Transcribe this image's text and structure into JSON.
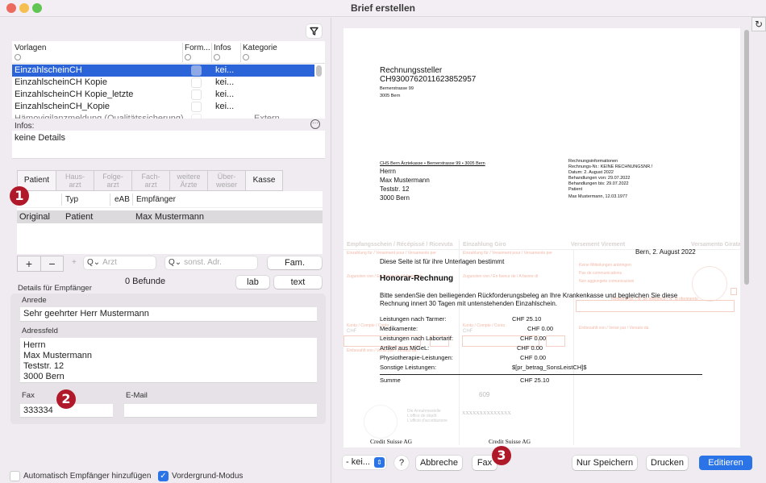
{
  "window": {
    "title": "Brief erstellen"
  },
  "templates": {
    "columns": [
      "Vorlagen",
      "Form...",
      "Infos",
      "Kategorie"
    ],
    "rows": [
      {
        "name": "EinzahlscheinCH",
        "form": false,
        "infos": "kei...",
        "category": "",
        "selected": true
      },
      {
        "name": "EinzahlscheinCH Kopie",
        "form": false,
        "infos": "kei...",
        "category": "",
        "selected": false
      },
      {
        "name": "EinzahlscheinCH Kopie_letzte",
        "form": false,
        "infos": "kei...",
        "category": "",
        "selected": false
      },
      {
        "name": "EinzahlscheinCH_Kopie",
        "form": false,
        "infos": "kei...",
        "category": "",
        "selected": false
      },
      {
        "name": "Hämovigilanzmeldung (Qualitätssicherung)",
        "form": true,
        "infos": "",
        "category": "Extern",
        "selected": false
      }
    ],
    "infos_label": "Infos:",
    "infos_value": "keine Details"
  },
  "recipient_tabs": [
    {
      "label": "Patient",
      "enabled": true
    },
    {
      "label": "Haus-\narzt",
      "enabled": false
    },
    {
      "label": "Folge-\narzt",
      "enabled": false
    },
    {
      "label": "Fach-\narzt",
      "enabled": false
    },
    {
      "label": "weitere\nÄrzte",
      "enabled": false
    },
    {
      "label": "Über-\nweiser",
      "enabled": false
    },
    {
      "label": "Kasse",
      "enabled": true
    }
  ],
  "recipients": {
    "columns": [
      "",
      "Typ",
      "eAB",
      "Empfänger"
    ],
    "rows": [
      {
        "kind": "Original",
        "type": "Patient",
        "eab": "",
        "name": "Max Mustermann"
      }
    ]
  },
  "recipient_controls": {
    "add": "+",
    "remove": "−",
    "small_plus": "+",
    "arzt_placeholder": "Arzt",
    "other_placeholder": "sonst. Adr.",
    "fam": "Fam.",
    "befunde": "0 Befunde",
    "lab": "lab",
    "text": "text"
  },
  "details": {
    "title": "Details für Empfänger",
    "anrede_label": "Anrede",
    "anrede_value": "Sehr geehrter Herr Mustermann",
    "address_label": "Adressfeld",
    "address_lines": [
      "Herrn",
      "Max Mustermann",
      "Teststr. 12",
      "3000 Bern"
    ],
    "fax_label": "Fax",
    "fax_value": "333334",
    "email_label": "E-Mail",
    "email_value": ""
  },
  "options": {
    "auto_recipient": {
      "label": "Automatisch Empfänger hinzufügen",
      "checked": false
    },
    "foreground_mode": {
      "label": "Vordergrund-Modus",
      "checked": true
    }
  },
  "badges": [
    "1",
    "2",
    "3"
  ],
  "preview": {
    "sender_title": "Rechnungssteller",
    "sender_iban": "CH9300762011623852957",
    "sender_street": "Bernerstrasse 99",
    "sender_city": "3005 Bern",
    "return_line": "CHS Bern Ärztekasse • Bernerstrasse 99 • 3005 Bern",
    "address": [
      "Herrn",
      "Max Mustermann",
      "Teststr. 12",
      "3000 Bern"
    ],
    "info_block": [
      "Rechnungsinformationen",
      "Rechnungs-Nr.: KEINE RECHNUNGSNR.!",
      "Datum: 2. August 2022",
      "Behandlungen von:  29.07.2022",
      "Behandlungen bis: 29.07.2022",
      "Patient",
      "Max Mustermann, 12.03.1977"
    ],
    "date_line": "Bern, 2. August 2022",
    "note": "Diese Seite ist für ihre Unterlagen bestimmt",
    "heading": "Honorar-Rechnung",
    "body_1": "Bitte sendenSie den beiliegenden Rückforderungsbeleg an Ihre Krankenkasse und begleichen Sie diese",
    "body_2": "Rechnung innert 30 Tagen mit untenstehenden Einzahlschein.",
    "items": [
      {
        "label": "Leistungen nach Tarmer:",
        "value": "CHF 25.10"
      },
      {
        "label": "Medikamente:",
        "value": "CHF 0.00"
      },
      {
        "label": "Leistungen nach Labortarif:",
        "value": "CHF 0.00"
      },
      {
        "label": "Artikel aus MiGeL:",
        "value": "CHF 0.00"
      },
      {
        "label": "Physiotherapie-Leistungen:",
        "value": "CHF 0.00"
      },
      {
        "label": "Sonstige Leistungen:",
        "value": "$[pr_betrag_SonsLeistCH]$"
      }
    ],
    "total_label": "Summe",
    "total_value": "CHF 25.10",
    "slip": {
      "h1": "Empfangsschein / Récépissé / Ricevuta",
      "h2": "Einzahlung Giro",
      "h3": "Versement Virement",
      "h4": "Versamento Girata",
      "for1": "Einzahlung für / Versement pour / Versamento per",
      "for2": "Einzahlung für / Versement pour / Versamento per",
      "fav1": "Zugunsten von / En faveur de / A favore di",
      "fav2": "Zugunsten von / En faveur de / A favore di",
      "msg1": "Keine Mitteilungen anbringen",
      "msg2": "Pas de communications",
      "msg3": "Non aggiungete comunicazioni",
      "ref": "Referenz-Nr. / N° de référence / N° di riferimento",
      "konto1": "Konto / Compte / Conto",
      "konto2": "Konto / Compte / Conto",
      "chf1": "CHF",
      "chf2": "CHF",
      "paidby1": "Einbezahlt von / Versé par / Versato da",
      "paidby2": "Einbezahlt von / Versé par / Versato da",
      "code": "609",
      "office1": "Die Annahmestelle",
      "office2": "L'office de dépôt",
      "office3": "L'ufficio d'accettazione",
      "xs": "XXXXXXXXXXXXXX",
      "bank1": "Credit Suisse AG",
      "bank2": "Credit Suisse AG"
    }
  },
  "footer": {
    "select_value": "- kei...",
    "help": "?",
    "cancel": "Abbreche",
    "fax": "Fax",
    "save_only": "Nur Speichern",
    "print": "Drucken",
    "edit": "Editieren"
  }
}
